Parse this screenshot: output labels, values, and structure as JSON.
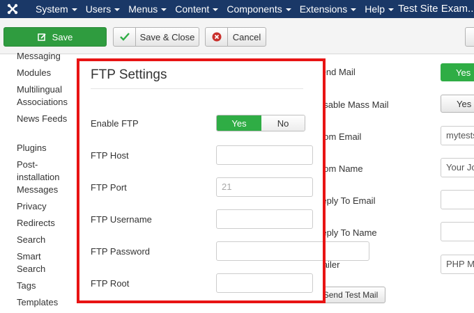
{
  "navbar": {
    "logo_icon": "joomla-logo-icon",
    "menu": [
      "System",
      "Users",
      "Menus",
      "Content",
      "Components",
      "Extensions",
      "Help"
    ],
    "site_name": "Test Site Exam..."
  },
  "toolbar": {
    "save_label": "Save",
    "save_close_label": "Save & Close",
    "cancel_label": "Cancel"
  },
  "sidebar": {
    "items": [
      "Messaging",
      "Modules",
      "Multilingual Associations",
      "News Feeds",
      "Plugins",
      "Post-installation Messages",
      "Privacy",
      "Redirects",
      "Search",
      "Smart Search",
      "Tags",
      "Templates"
    ]
  },
  "ftp": {
    "title": "FTP Settings",
    "enable_label": "Enable FTP",
    "enable_yes": "Yes",
    "enable_no": "No",
    "host_label": "FTP Host",
    "host_value": "",
    "port_label": "FTP Port",
    "port_placeholder": "21",
    "username_label": "FTP Username",
    "username_value": "",
    "password_label": "FTP Password",
    "password_value": "",
    "root_label": "FTP Root",
    "root_value": ""
  },
  "mail": {
    "send_mail_label": "Send Mail",
    "send_mail_value": "Yes",
    "disable_mass_label": "Disable Mass Mail",
    "disable_mass_value": "Yes",
    "from_email_label": "From Email",
    "from_email_value": "mytests",
    "from_name_label": "From Name",
    "from_name_value": "Your Jo",
    "reply_email_label": "Reply To Email",
    "reply_email_value": "",
    "reply_name_label": "Reply To Name",
    "reply_name_value": "",
    "mailer_label": "Mailer",
    "mailer_value": "PHP M",
    "send_test_label": "Send Test Mail"
  },
  "colors": {
    "navbar": "#1a3867",
    "save_green": "#2f9c3f",
    "toggle_green": "#2fad45",
    "highlight_red": "#e81414"
  }
}
